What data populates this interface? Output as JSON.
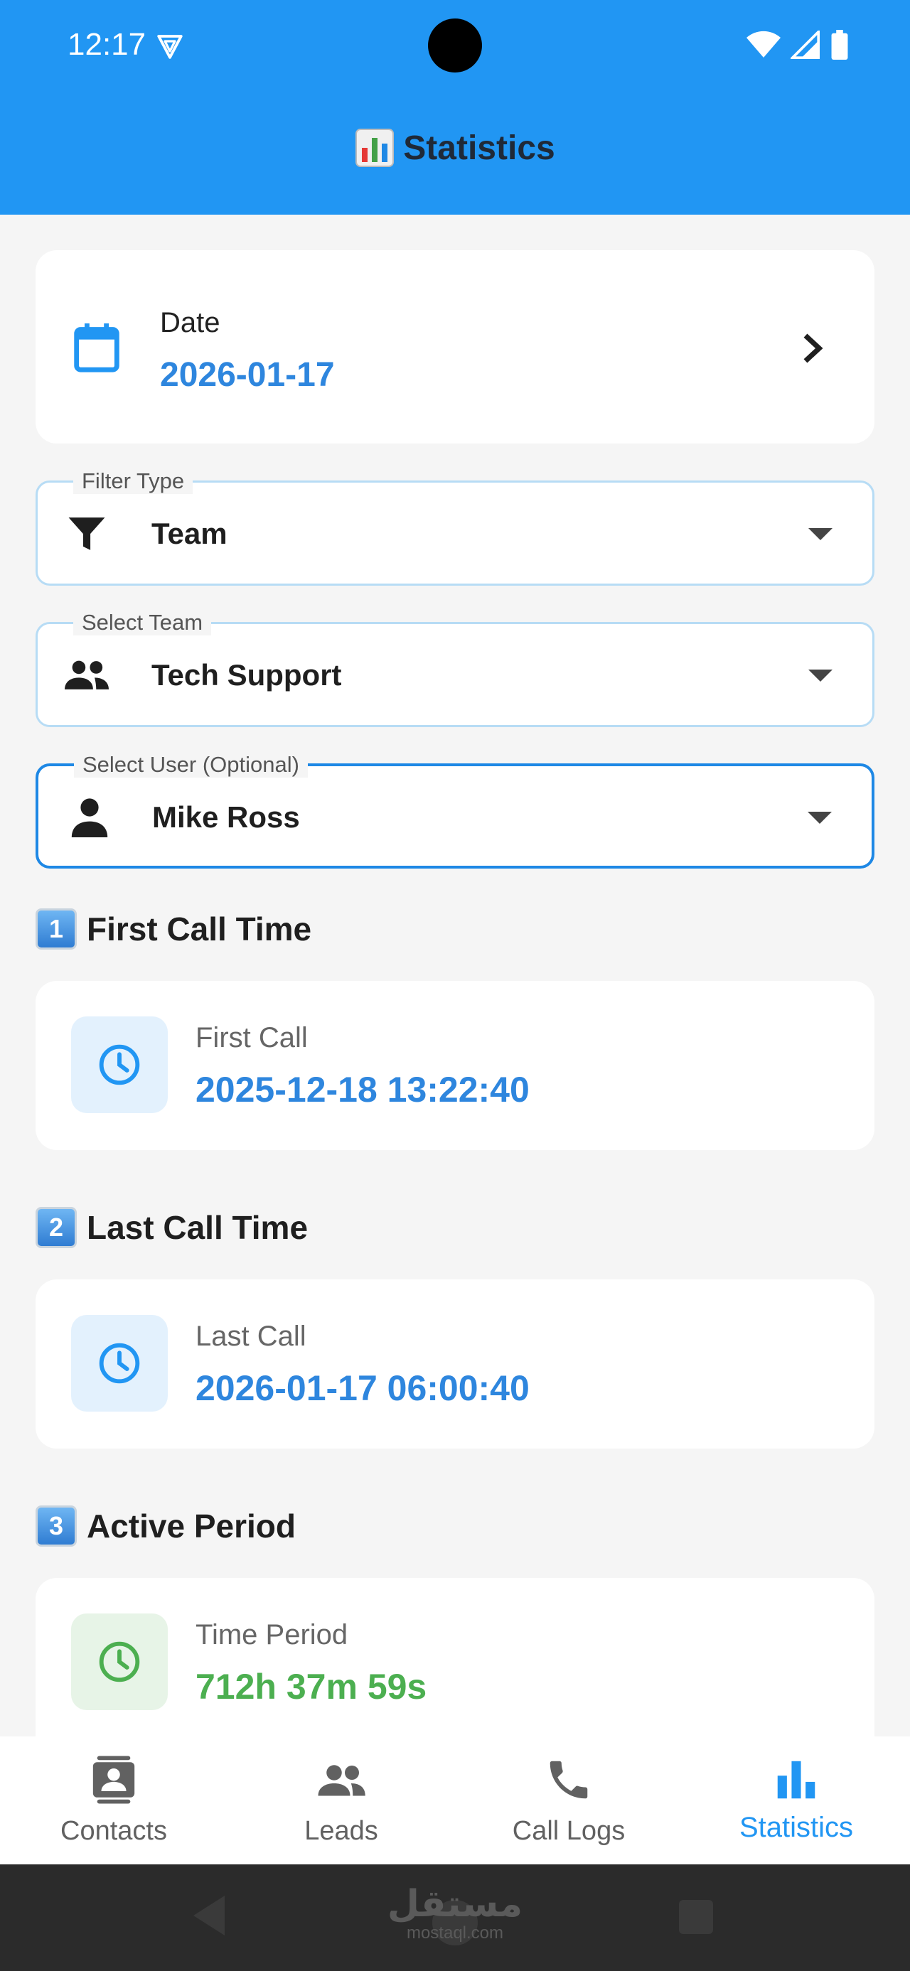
{
  "status_bar": {
    "time": "12:17"
  },
  "header": {
    "title": "Statistics",
    "emoji_icon": "bar-chart-emoji"
  },
  "date_card": {
    "label": "Date",
    "value": "2026-01-17"
  },
  "filter_type": {
    "label": "Filter Type",
    "value": "Team"
  },
  "select_team": {
    "label": "Select Team",
    "value": "Tech Support"
  },
  "select_user": {
    "label": "Select User (Optional)",
    "value": "Mike Ross"
  },
  "sections": [
    {
      "number": "1",
      "title": "First Call Time",
      "stat_label": "First Call",
      "stat_value": "2025-12-18 13:22:40",
      "color": "#2e86de"
    },
    {
      "number": "2",
      "title": "Last Call Time",
      "stat_label": "Last Call",
      "stat_value": "2026-01-17 06:00:40",
      "color": "#2e86de"
    },
    {
      "number": "3",
      "title": "Active Period",
      "stat_label": "Time Period",
      "stat_value": "712h 37m 59s",
      "color": "#4caf50"
    }
  ],
  "bottom_nav": {
    "items": [
      {
        "label": "Contacts",
        "icon": "contacts-icon"
      },
      {
        "label": "Leads",
        "icon": "group-icon"
      },
      {
        "label": "Call Logs",
        "icon": "phone-icon"
      },
      {
        "label": "Statistics",
        "icon": "bar-chart-icon",
        "active": true
      }
    ]
  },
  "watermark": {
    "arabic": "مستقل",
    "latin": "mostaql.com"
  },
  "colors": {
    "primary": "#2196f3",
    "accent_blue": "#2e86de",
    "accent_green": "#4caf50"
  }
}
